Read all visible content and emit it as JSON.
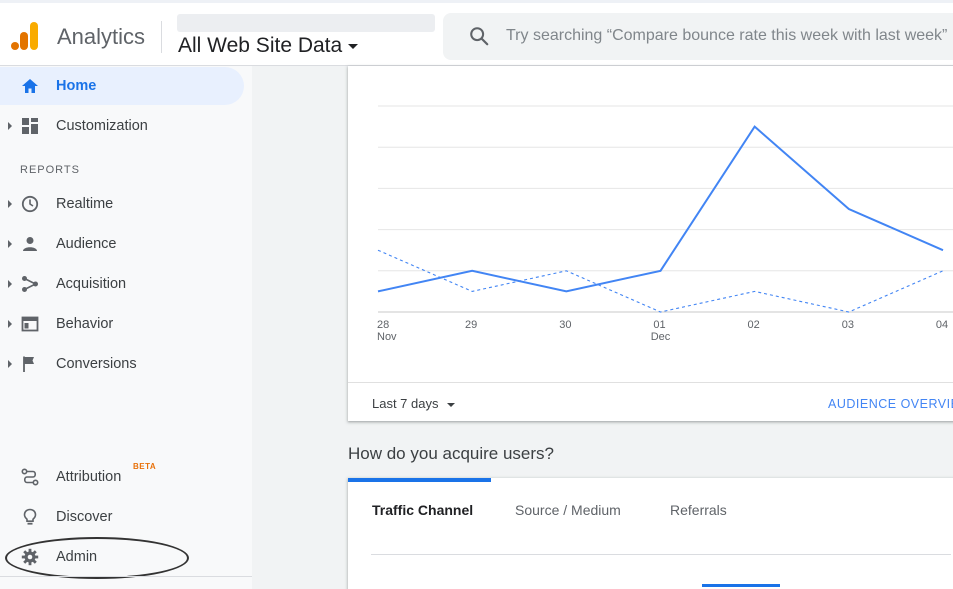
{
  "header": {
    "app_name": "Analytics",
    "property_name": "All Web Site Data",
    "search_placeholder": "Try searching “Compare bounce rate this week with last week”"
  },
  "sidebar": {
    "home": "Home",
    "customization": "Customization",
    "reports_header": "REPORTS",
    "items": [
      {
        "label": "Realtime",
        "icon": "clock-icon"
      },
      {
        "label": "Audience",
        "icon": "person-icon"
      },
      {
        "label": "Acquisition",
        "icon": "acquisition-icon"
      },
      {
        "label": "Behavior",
        "icon": "behavior-icon"
      },
      {
        "label": "Conversions",
        "icon": "flag-icon"
      }
    ],
    "attribution": "Attribution",
    "attribution_badge": "BETA",
    "discover": "Discover",
    "admin": "Admin"
  },
  "chart_card": {
    "date_range": "Last 7 days",
    "overview_link": "AUDIENCE OVERVIEW"
  },
  "chart_data": {
    "type": "line",
    "x_ticks": [
      {
        "day": "28",
        "month": "Nov"
      },
      {
        "day": "29",
        "month": ""
      },
      {
        "day": "30",
        "month": ""
      },
      {
        "day": "01",
        "month": "Dec"
      },
      {
        "day": "02",
        "month": ""
      },
      {
        "day": "03",
        "month": ""
      },
      {
        "day": "04",
        "month": ""
      }
    ],
    "series": [
      {
        "style": "solid",
        "color": "#4285f4",
        "values": [
          1,
          2,
          1,
          2,
          9,
          5,
          3
        ]
      },
      {
        "style": "dashed",
        "color": "#4285f4",
        "values": [
          3,
          1,
          2,
          0,
          1,
          0,
          2
        ]
      }
    ],
    "ylim": [
      0,
      10
    ],
    "grid": true
  },
  "acquire": {
    "title": "How do you acquire users?",
    "tabs": [
      "Traffic Channel",
      "Source / Medium",
      "Referrals"
    ]
  },
  "colors": {
    "accent": "#1a73e8",
    "chart_line": "#4285f4",
    "logo_orange": "#f9ab00",
    "logo_dark_orange": "#e37400"
  }
}
